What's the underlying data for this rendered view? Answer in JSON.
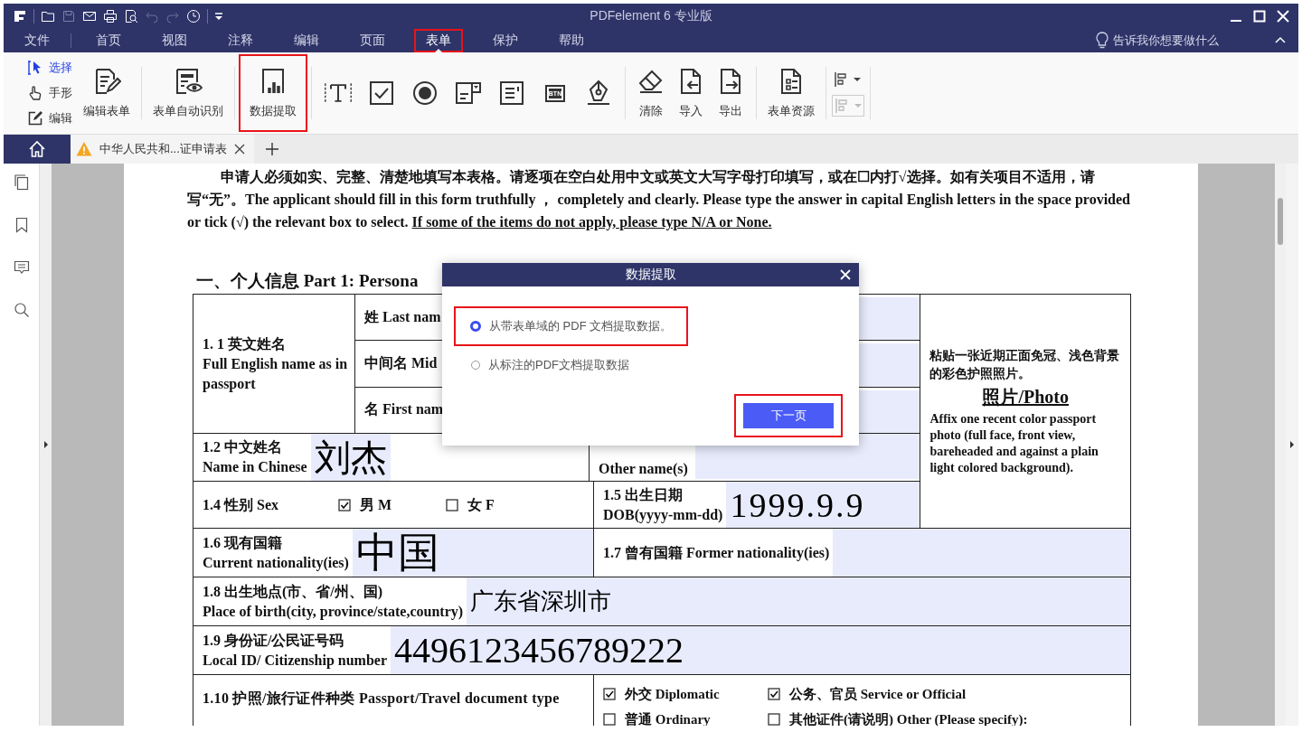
{
  "window": {
    "title": "PDFelement  6 专业版"
  },
  "menu": [
    {
      "label": "文件",
      "selected": false,
      "highlighted": false
    },
    {
      "label": "首页",
      "selected": false,
      "highlighted": false
    },
    {
      "label": "视图",
      "selected": false,
      "highlighted": false
    },
    {
      "label": "注释",
      "selected": false,
      "highlighted": false
    },
    {
      "label": "编辑",
      "selected": false,
      "highlighted": false
    },
    {
      "label": "页面",
      "selected": false,
      "highlighted": false
    },
    {
      "label": "表单",
      "selected": true,
      "highlighted": true
    },
    {
      "label": "保护",
      "selected": false,
      "highlighted": false
    },
    {
      "label": "帮助",
      "selected": false,
      "highlighted": false
    }
  ],
  "tell_me": "告诉我你想要做什么",
  "ribbon": {
    "modes": [
      {
        "kind": "select",
        "label": "选择",
        "selected": true
      },
      {
        "kind": "hand",
        "label": "手形",
        "selected": false
      },
      {
        "kind": "edit",
        "label": "编辑",
        "selected": false
      }
    ],
    "tools": [
      {
        "kind": "edit-form",
        "label": "编辑表单",
        "highlighted": false
      },
      {
        "kind": "recognize",
        "label": "表单自动识别",
        "highlighted": false
      },
      {
        "kind": "extract",
        "label": "数据提取",
        "highlighted": true
      }
    ],
    "field_tools": [
      {
        "kind": "text"
      },
      {
        "kind": "checkbox"
      },
      {
        "kind": "radio"
      },
      {
        "kind": "combo"
      },
      {
        "kind": "list"
      },
      {
        "kind": "button",
        "text": "BTN"
      },
      {
        "kind": "signature"
      }
    ],
    "data_tools": [
      {
        "kind": "clear",
        "label": "清除"
      },
      {
        "kind": "import",
        "label": "导入"
      },
      {
        "kind": "export",
        "label": "导出"
      }
    ],
    "resource_tool": {
      "label": "表单资源"
    },
    "align_tools": [
      {
        "disabled": false
      },
      {
        "disabled": true
      }
    ]
  },
  "tabs": [
    {
      "title": "中华人民共和...证申请表",
      "warning": true
    }
  ],
  "document": {
    "instruction": "申请人必须如实、完整、清楚地填写本表格。请逐项在空白处用中文或英文大写字母打印填写，或在☐内打√选择。如有关项目不适用，请写“无”。The applicant should fill in this form truthfully ， completely and clearly. Please type the answer in capital English letters in the space provided or tick (√) the relevant box to select.",
    "instruction_note": "If some of the items do not apply, please type N/A or None.",
    "section_title": "一、个人信息  Part 1: Persona",
    "name_block": {
      "label_zh": "1. 1 英文姓名",
      "label_en": "Full English name as in passport",
      "parts": [
        {
          "label": "姓 Last nam"
        },
        {
          "label": "中间名 Mid"
        },
        {
          "label": "名 First nam"
        }
      ]
    },
    "chinese_name": {
      "label_zh": "1.2 中文姓名",
      "label_en": "Name in Chinese",
      "value": "刘杰"
    },
    "other_names": {
      "label": "Other name(s)"
    },
    "sex": {
      "label": "1.4 性别 Sex",
      "options": [
        {
          "label": "男  M",
          "checked": true
        },
        {
          "label": "女  F",
          "checked": false
        }
      ]
    },
    "dob": {
      "label_zh": "1.5 出生日期",
      "label_en": "DOB(yyyy-mm-dd)",
      "value": "1999.9.9"
    },
    "nationality": {
      "label_zh": "1.6 现有国籍",
      "label_en": "Current nationality(ies)",
      "value": "中国"
    },
    "former_nationality": {
      "label": "1.7 曾有国籍 Former nationality(ies)"
    },
    "birthplace": {
      "label_zh": "1.8 出生地点(市、省/州、国)",
      "label_en": "Place of birth(city, province/state,country)",
      "value": "广东省深圳市"
    },
    "local_id": {
      "label_zh": "1.9 身份证/公民证号码",
      "label_en": "Local ID/ Citizenship number",
      "value": "4496123456789222"
    },
    "document_type": {
      "label": "1.10 护照/旅行证件种类 Passport/Travel document type",
      "options": [
        {
          "label": "外交 Diplomatic",
          "checked": true
        },
        {
          "label": "公务、官员 Service or Official",
          "checked": true
        },
        {
          "label": "普通 Ordinary",
          "checked": false
        },
        {
          "label": "其他证件(请说明) Other (Please specify):",
          "checked": false
        }
      ]
    },
    "photo": {
      "instruction_zh": "粘贴一张近期正面免冠、浅色背景的彩色护照照片。",
      "title": "照片/Photo",
      "instruction_en": "Affix one recent color passport photo (full face, front view, bareheaded and against a plain light colored background)."
    }
  },
  "dialog": {
    "title": "数据提取",
    "options": [
      {
        "label": "从带表单域的 PDF 文档提取数据。",
        "selected": true,
        "highlighted": true
      },
      {
        "label": "从标注的PDF文档提取数据",
        "selected": false,
        "highlighted": false
      }
    ],
    "next_button": {
      "label": "下一页",
      "highlighted": true
    }
  }
}
